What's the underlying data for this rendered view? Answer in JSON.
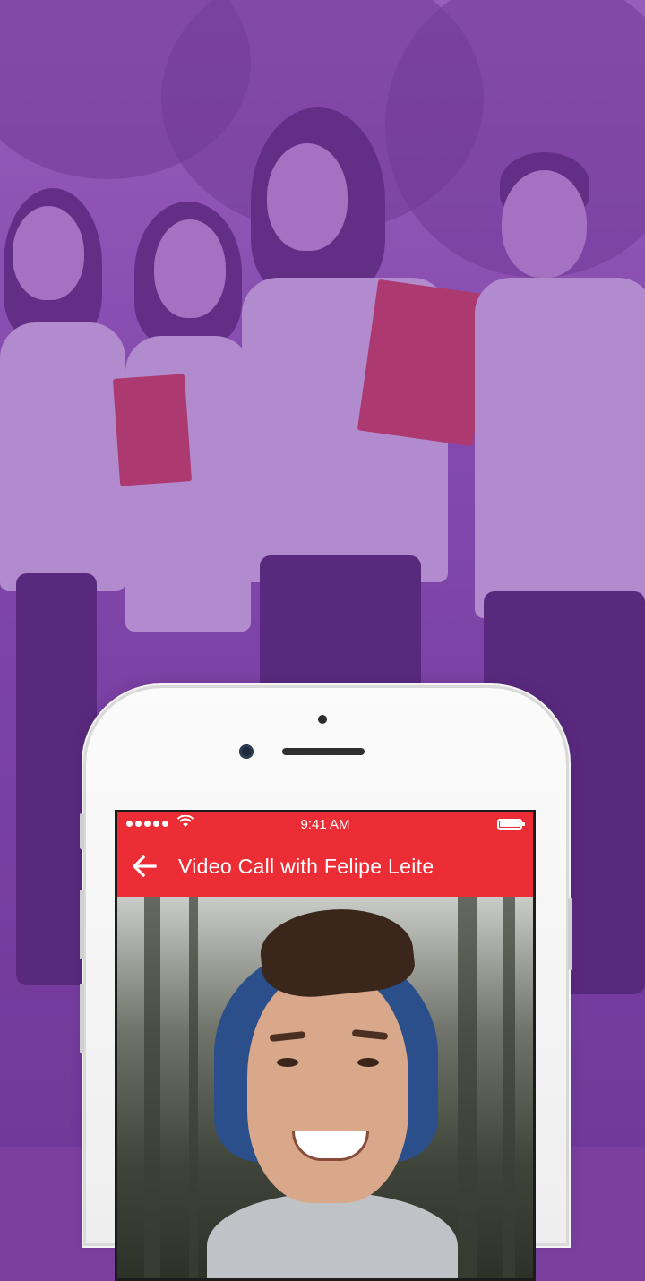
{
  "status_bar": {
    "time": "9:41 AM",
    "signal_icon": "signal-dots-icon",
    "wifi_icon": "wifi-icon",
    "battery_icon": "battery-icon"
  },
  "app_bar": {
    "back_icon": "arrow-back-icon",
    "title": "Video Call with Felipe Leite"
  },
  "colors": {
    "accent_red": "#ec2d36",
    "background_purple": "#8d55b5"
  }
}
